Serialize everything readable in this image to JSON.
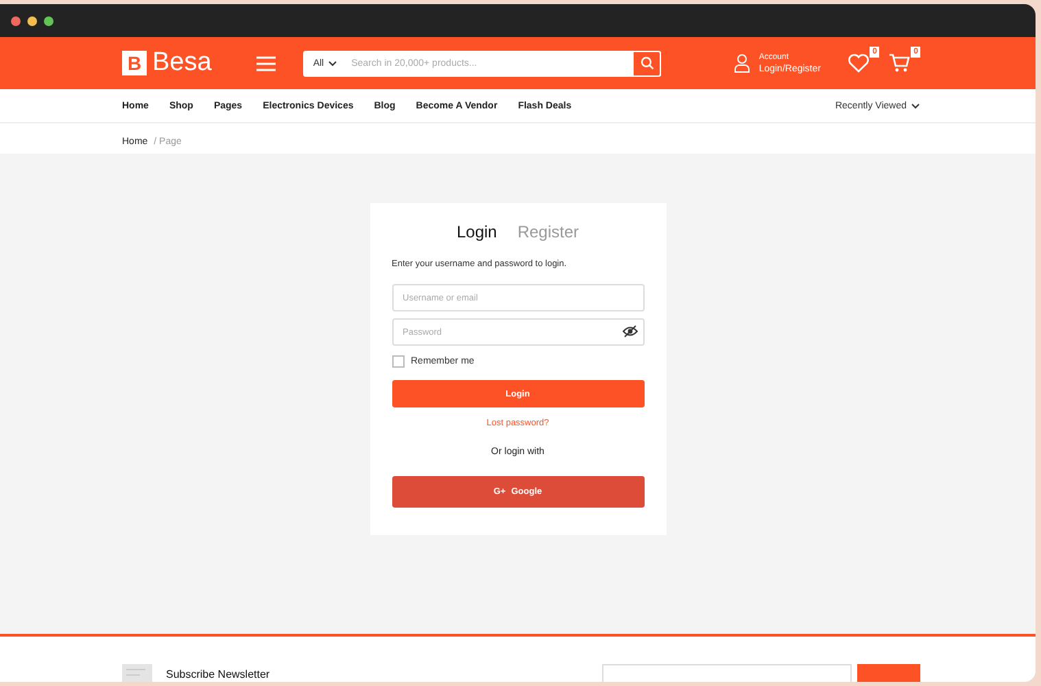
{
  "header": {
    "logo_letter": "B",
    "logo_text": "Besa",
    "search": {
      "category": "All",
      "placeholder": "Search in 20,000+ products..."
    },
    "account": {
      "label": "Account",
      "link": "Login/Register"
    },
    "wishlist_count": "0",
    "cart_count": "0"
  },
  "nav": {
    "items": [
      "Home",
      "Shop",
      "Pages",
      "Electronics Devices",
      "Blog",
      "Become A Vendor",
      "Flash Deals"
    ],
    "recent": "Recently Viewed"
  },
  "breadcrumb": {
    "home": "Home",
    "current": "/ Page"
  },
  "login": {
    "tabs": [
      {
        "label": "Login",
        "selected": true
      },
      {
        "label": "Register",
        "selected": false
      }
    ],
    "intro": "Enter your username and password to login.",
    "username_placeholder": "Username or email",
    "password_placeholder": "Password",
    "remember": {
      "label": "Remember me",
      "checked": false
    },
    "submit": "Login",
    "lost": "Lost password?",
    "or": "Or login with",
    "google_icon": "G+",
    "google": "Google"
  },
  "footer": {
    "newsletter": "Subscribe Newsletter"
  }
}
